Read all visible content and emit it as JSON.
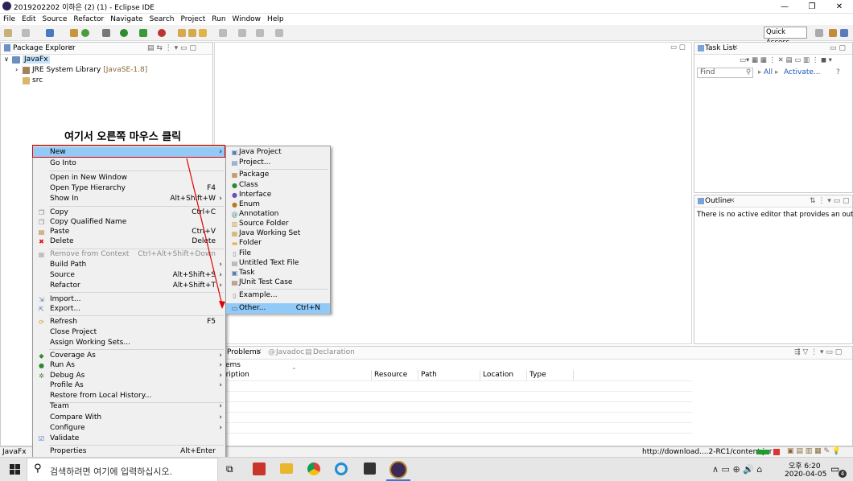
{
  "window": {
    "title": "2019202202 이하은 (2) (1) - Eclipse IDE",
    "min": "—",
    "max": "❐",
    "close": "✕"
  },
  "menubar": [
    "File",
    "Edit",
    "Source",
    "Refactor",
    "Navigate",
    "Search",
    "Project",
    "Run",
    "Window",
    "Help"
  ],
  "toolbar": {
    "quick_access": "Quick Access"
  },
  "package_explorer": {
    "tab": "Package Explorer",
    "project": "JavaFx",
    "jre_label": "JRE System Library",
    "jre_version": "[JavaSE-1.8]",
    "src": "src"
  },
  "annotation": {
    "text": "여기서 오른쪽 마우스 클릭",
    "color": "#e00000"
  },
  "context_menu": [
    {
      "label": "New",
      "accel": "",
      "arrow": true,
      "highlight": true
    },
    {
      "label": "Go Into",
      "accel": ""
    },
    {
      "label": "Open in New Window",
      "accel": ""
    },
    {
      "label": "Open Type Hierarchy",
      "accel": "F4"
    },
    {
      "label": "Show In",
      "accel": "Alt+Shift+W",
      "arrow": true
    },
    {
      "label": "Copy",
      "accel": "Ctrl+C"
    },
    {
      "label": "Copy Qualified Name",
      "accel": ""
    },
    {
      "label": "Paste",
      "accel": "Ctrl+V"
    },
    {
      "label": "Delete",
      "accel": "Delete"
    },
    {
      "label": "Remove from Context",
      "accel": "Ctrl+Alt+Shift+Down",
      "disabled": true
    },
    {
      "label": "Build Path",
      "accel": "",
      "arrow": true
    },
    {
      "label": "Source",
      "accel": "Alt+Shift+S",
      "arrow": true
    },
    {
      "label": "Refactor",
      "accel": "Alt+Shift+T",
      "arrow": true
    },
    {
      "label": "Import...",
      "accel": ""
    },
    {
      "label": "Export...",
      "accel": ""
    },
    {
      "label": "Refresh",
      "accel": "F5"
    },
    {
      "label": "Close Project",
      "accel": ""
    },
    {
      "label": "Assign Working Sets...",
      "accel": ""
    },
    {
      "label": "Coverage As",
      "accel": "",
      "arrow": true
    },
    {
      "label": "Run As",
      "accel": "",
      "arrow": true
    },
    {
      "label": "Debug As",
      "accel": "",
      "arrow": true
    },
    {
      "label": "Profile As",
      "accel": "",
      "arrow": true
    },
    {
      "label": "Restore from Local History...",
      "accel": ""
    },
    {
      "label": "Team",
      "accel": "",
      "arrow": true
    },
    {
      "label": "Compare With",
      "accel": "",
      "arrow": true
    },
    {
      "label": "Configure",
      "accel": "",
      "arrow": true
    },
    {
      "label": "Validate",
      "accel": ""
    },
    {
      "label": "Properties",
      "accel": "Alt+Enter"
    }
  ],
  "submenu": [
    {
      "label": "Java Project"
    },
    {
      "label": "Project..."
    },
    {
      "label": "Package"
    },
    {
      "label": "Class"
    },
    {
      "label": "Interface"
    },
    {
      "label": "Enum"
    },
    {
      "label": "Annotation"
    },
    {
      "label": "Source Folder"
    },
    {
      "label": "Java Working Set"
    },
    {
      "label": "Folder"
    },
    {
      "label": "File"
    },
    {
      "label": "Untitled Text File"
    },
    {
      "label": "Task"
    },
    {
      "label": "JUnit Test Case"
    },
    {
      "label": "Example..."
    },
    {
      "label": "Other...",
      "accel": "Ctrl+N",
      "highlight": true
    }
  ],
  "task_list": {
    "tab": "Task List",
    "find": "Find",
    "all": "All",
    "activate": "Activate..."
  },
  "outline": {
    "tab": "Outline",
    "message": "There is no active editor that provides an outline."
  },
  "problems": {
    "tabs": [
      "Problems",
      "Javadoc",
      "Declaration"
    ],
    "items_label": "ems",
    "columns": [
      "scription",
      "Resource",
      "Path",
      "Location",
      "Type"
    ]
  },
  "status": {
    "left": "JavaFx",
    "right": "http://download....2-RC1/content.jar"
  },
  "taskbar": {
    "search_placeholder": "검색하려면 여기에 입력하십시오.",
    "time": "오후 6:20",
    "date": "2020-04-05",
    "notif": "4"
  }
}
